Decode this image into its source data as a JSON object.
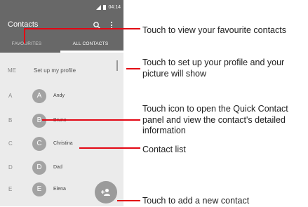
{
  "status_bar": {
    "time": "04:14"
  },
  "app_bar": {
    "title": "Contacts",
    "search_icon": "search-icon",
    "more_icon": "more-vert-icon",
    "tabs": [
      {
        "label": "FAVOURITES",
        "selected": false
      },
      {
        "label": "ALL CONTACTS",
        "selected": true
      }
    ]
  },
  "profile": {
    "label": "ME",
    "text": "Set up my profile"
  },
  "contacts": [
    {
      "section": "A",
      "initial": "A",
      "name": "Andy"
    },
    {
      "section": "B",
      "initial": "B",
      "name": "Bruno"
    },
    {
      "section": "C",
      "initial": "C",
      "name": "Christina"
    },
    {
      "section": "D",
      "initial": "D",
      "name": "Dad"
    },
    {
      "section": "E",
      "initial": "E",
      "name": "Elena"
    }
  ],
  "fab": {
    "icon": "add-contact-icon"
  },
  "callouts": [
    "Touch to view your favourite contacts",
    "Touch to set up your profile and your picture will show",
    "Touch icon to open the Quick Contact panel and view the contact's detailed information",
    "Contact list",
    "Touch to add a new contact"
  ],
  "colors": {
    "app_bar": "#686868",
    "list_background": "#ebebeb",
    "avatar": "#a3a3a3",
    "callout_line": "#e30613"
  }
}
